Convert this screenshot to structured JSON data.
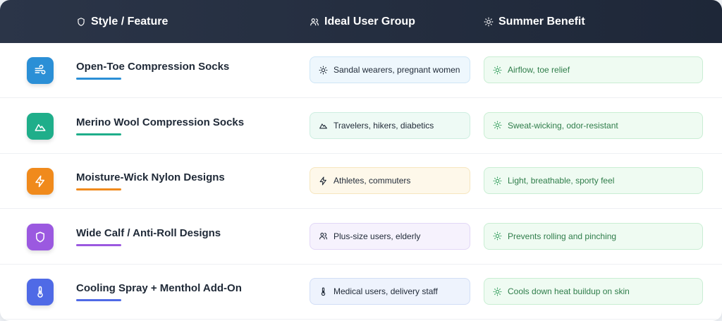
{
  "header": {
    "style_feature": "Style / Feature",
    "ideal_user_group": "Ideal User Group",
    "summer_benefit": "Summer Benefit",
    "icons": [
      "shield-icon",
      "users-icon",
      "sun-icon"
    ]
  },
  "rows": [
    {
      "title": "Open-Toe Compression Socks",
      "icon": "wind-icon",
      "accent": "#2b8fd6",
      "users": "Sandal wearers, pregnant women",
      "users_icon": "sun-icon",
      "users_bg": "#eef7fd",
      "users_border": "#cfe6f6",
      "benefit": "Airflow, toe relief"
    },
    {
      "title": "Merino Wool Compression Socks",
      "icon": "mountain-icon",
      "accent": "#1fae8a",
      "users": "Travelers, hikers, diabetics",
      "users_icon": "mountain-icon",
      "users_bg": "#eefaf5",
      "users_border": "#cdeee0",
      "benefit": "Sweat-wicking, odor-resistant"
    },
    {
      "title": "Moisture-Wick Nylon Designs",
      "icon": "lightning-icon",
      "accent": "#f08a1c",
      "users": "Athletes, commuters",
      "users_icon": "lightning-icon",
      "users_bg": "#fef8ea",
      "users_border": "#f6e6bf",
      "benefit": "Light, breathable, sporty feel"
    },
    {
      "title": "Wide Calf / Anti-Roll Designs",
      "icon": "shield-icon",
      "accent": "#9b59e0",
      "users": "Plus-size users, elderly",
      "users_icon": "users-icon",
      "users_bg": "#f6f2fd",
      "users_border": "#e2d7f6",
      "benefit": "Prevents rolling and pinching"
    },
    {
      "title": "Cooling Spray + Menthol Add-On",
      "icon": "thermometer-icon",
      "accent": "#4f6ae6",
      "users": "Medical users, delivery staff",
      "users_icon": "thermometer-icon",
      "users_bg": "#eef3fd",
      "users_border": "#d2def6",
      "benefit": "Cools down heat buildup on skin"
    }
  ],
  "benefit_icon": "sun-icon"
}
